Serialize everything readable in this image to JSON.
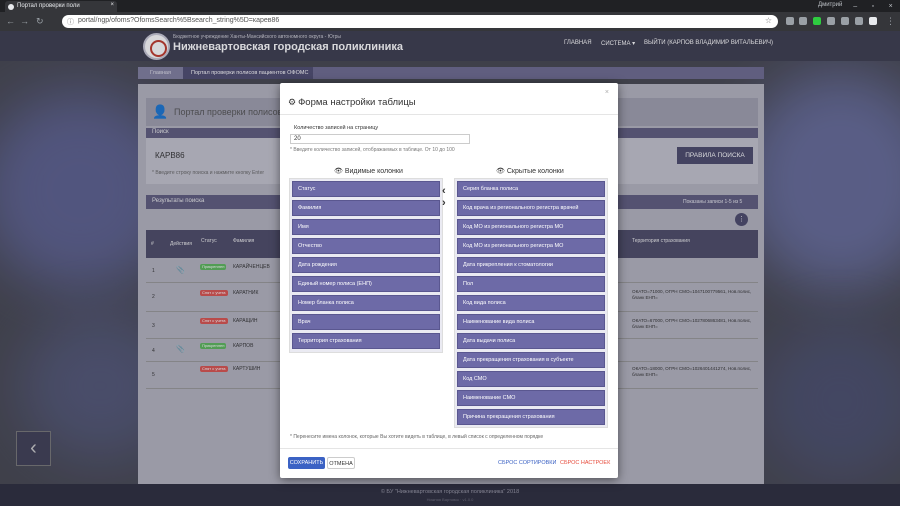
{
  "browser": {
    "tab_title": "Портал проверки поли",
    "address": "portal/ngp/ofoms?OfomsSearch%5Bsearch_string%5D=карев86",
    "user": "Дмитрий",
    "colors": {
      "chrome_dark": "#202124",
      "toolbar": "#35363a"
    }
  },
  "site": {
    "org_sub": "Бюджетное учреждение Ханты-Мансийского автономного округа - Югры",
    "org_name": "Нижневартовская городская поликлиника",
    "nav": {
      "home": "ГЛАВНАЯ",
      "system": "СИСТЕМА ▾",
      "logout": "ВЫЙТИ (КАРПОВ ВЛАДИМИР ВИТАЛЬЕВИЧ)"
    },
    "breadcrumb": [
      "Главная",
      "Портал проверки полисов пациентов ОФОМС"
    ],
    "page_title": "Портал проверки полисов пациен",
    "search": {
      "label": "Поиск",
      "value": "КАРВ86",
      "hint": "* Введите строку поиска и нажмите кнопку Enter",
      "rules_button": "ПРАВИЛА ПОИСКА"
    },
    "results": {
      "label": "Результаты поиска",
      "count": "Показаны записи 1-5 из 5",
      "headers": [
        "#",
        "Действия",
        "Статус",
        "Фамилия",
        "Территория страхования"
      ],
      "rows": [
        {
          "n": "1",
          "status": "Прикреплен",
          "status_color": "#5cb85c",
          "name": "КАРАЙЧЕНЦЕВ",
          "terr": ""
        },
        {
          "n": "2",
          "status": "Снят с учета",
          "status_color": "#d9534f",
          "name": "КАРАТНИК",
          "terr": "ОКАТО=71000, ОГРН СМО=1047100779561, Нов.полис, бланк ЕНП="
        },
        {
          "n": "3",
          "status": "Снят с учета",
          "status_color": "#d9534f",
          "name": "КАРАЩИН",
          "terr": "ОКАТО=67000, ОГРН СМО=1027806863481, Нов.полис, бланк ЕНП="
        },
        {
          "n": "4",
          "status": "Прикреплен",
          "status_color": "#5cb85c",
          "name": "КАРПОВ",
          "terr": ""
        },
        {
          "n": "5",
          "status": "Снят с учета",
          "status_color": "#d9534f",
          "name": "КАРТУШИН",
          "terr": "ОКАТО=18000, ОГРН СМО=1026401441274, Нов.полис, бланк ЕНП="
        }
      ]
    },
    "footer_line1": "© БУ \"Нижневартовская городская поликлиника\" 2018",
    "footer_line2": "Нижняя Вартовск · v1.0.0"
  },
  "modal": {
    "title": "Форма настройки таблицы",
    "close": "×",
    "per_page_label": "Количество записей на страницу",
    "per_page_value": "20",
    "per_page_hint": "* Введите количество записей, отображаемых в таблице. От 10 до 100",
    "visible_header": "Видимые колонки",
    "hidden_header": "Скрытые колонки",
    "visible_columns": [
      "Статус",
      "Фамилия",
      "Имя",
      "Отчество",
      "Дата рождения",
      "Единый номер полиса (ЕНП)",
      "Номер бланка полиса",
      "Врач",
      "Территория страхования"
    ],
    "hidden_columns": [
      "Серия бланка полиса",
      "Код врача из регионального регистра врачей",
      "Код МО из регионального регистра МО",
      "Код МО из регионального регистра МО",
      "Дата прикрепления к стоматологии",
      "Пол",
      "Код вида полиса",
      "Наименование вида полиса",
      "Дата выдачи полиса",
      "Дата прекращения страхования в субъекте",
      "Код СМО",
      "Наименование СМО",
      "Причина прекращения страхования"
    ],
    "footnote": "* Перенесите имена колонок, которые Вы хотите видеть в таблице, в левый список с определенном порядке",
    "save": "СОХРАНИТЬ",
    "cancel": "ОТМЕНА",
    "reset_sort": "СБРОС СОРТИРОВКИ",
    "reset_settings": "СБРОС НАСТРОЕК",
    "colors": {
      "item": "#6d6aa7",
      "save": "#3b62c4",
      "reset_sort": "#3b62c4",
      "reset_settings": "#e74c3c"
    }
  }
}
